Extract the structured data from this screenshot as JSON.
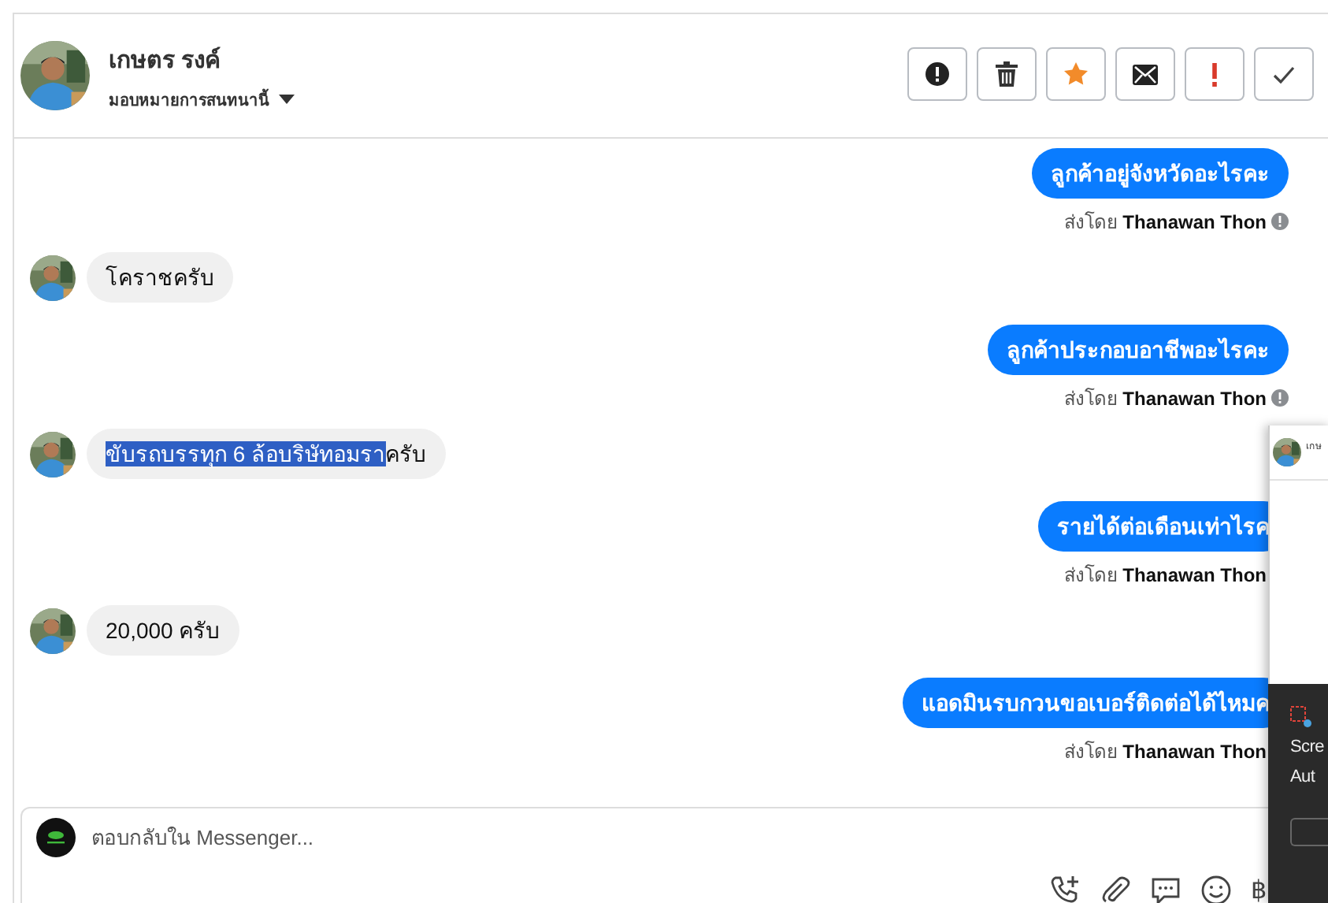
{
  "contact": {
    "name": "เกษตร รงค์",
    "assign_label": "มอบหมายการสนทนานี้"
  },
  "toolbar": [
    {
      "kind": "alert"
    },
    {
      "kind": "trash"
    },
    {
      "kind": "star"
    },
    {
      "kind": "mail"
    },
    {
      "kind": "important"
    },
    {
      "kind": "done"
    }
  ],
  "messages": [
    {
      "kind": "outgoing",
      "parts": [
        {
          "text": "ลูกค้าอยู่จังหวัดอะไรคะ",
          "selected": false
        }
      ],
      "sender_label": "ส่งโดย",
      "sender": "Thanawan Thon",
      "info_icon": true
    },
    {
      "kind": "incoming",
      "parts": [
        {
          "text": "โคราชครับ",
          "selected": false
        }
      ]
    },
    {
      "kind": "outgoing",
      "parts": [
        {
          "text": "ลูกค้าประกอบอาชีพอะไรคะ",
          "selected": false
        }
      ],
      "sender_label": "ส่งโดย",
      "sender": "Thanawan Thon",
      "info_icon": true
    },
    {
      "kind": "incoming",
      "parts": [
        {
          "text": "ขับรถบรรทุก 6 ล้อบริษัทอมรา",
          "selected": true
        },
        {
          "text": "ครับ",
          "selected": false
        }
      ]
    },
    {
      "kind": "outgoing",
      "parts": [
        {
          "text": "รายได้ต่อเดือนเท่าไรค",
          "selected": false
        }
      ],
      "sender_label": "ส่งโดย",
      "sender": "Thanawan Thon",
      "info_icon": false
    },
    {
      "kind": "incoming",
      "parts": [
        {
          "text": "20,000 ครับ",
          "selected": false
        }
      ]
    },
    {
      "kind": "outgoing",
      "parts": [
        {
          "text": "แอดมินรบกวนขอเบอร์ติดต่อได้ไหมค",
          "selected": false
        }
      ],
      "sender_label": "ส่งโดย",
      "sender": "Thanawan Thon",
      "info_icon": false
    }
  ],
  "composer": {
    "placeholder": "ตอบกลับใน Messenger...",
    "tools": [
      {
        "kind": "call"
      },
      {
        "kind": "attach"
      },
      {
        "kind": "chat"
      },
      {
        "kind": "emoji"
      },
      {
        "kind": "text",
        "label": "฿"
      }
    ]
  },
  "overlay": {
    "chat_title": "เกษ",
    "toast_lines": [
      "Scre",
      "Aut"
    ]
  }
}
